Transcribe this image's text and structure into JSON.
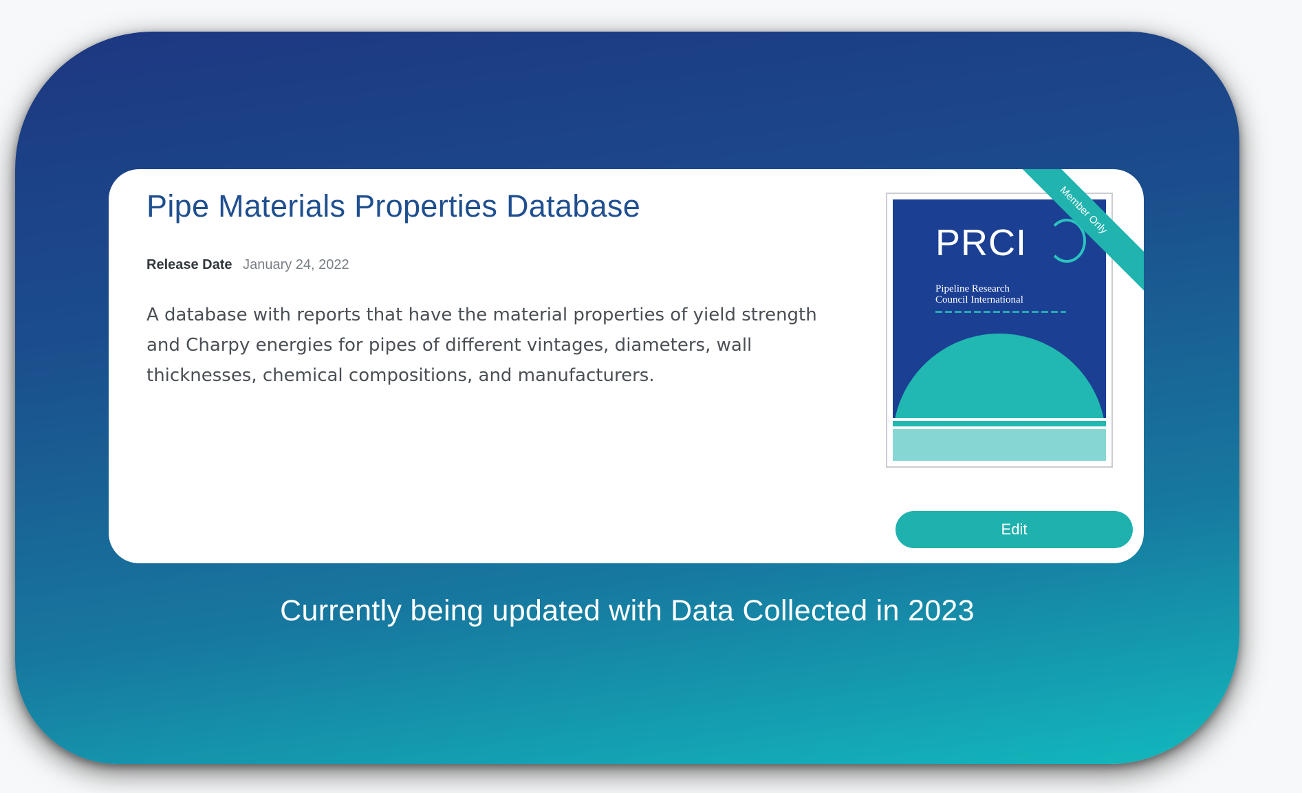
{
  "card": {
    "title": "Pipe Materials Properties Database",
    "release_label": "Release Date",
    "release_date": "January 24, 2022",
    "description": "A database with reports that have the material properties of yield strength and Charpy energies for pipes of different vintages, diameters, wall thicknesses, chemical compositions, and manufacturers.",
    "ribbon_label": "Member Only",
    "edit_label": "Edit",
    "cover": {
      "logo_text": "PRCI",
      "org_name": "Pipeline Research\nCouncil International"
    }
  },
  "footer_note": "Currently being updated with Data Collected in 2023",
  "colors": {
    "title": "#1f4f8f",
    "accent": "#1fb1ad",
    "cover_navy": "#1b3f93",
    "panel_gradient_start": "#1d3781",
    "panel_gradient_end": "#12b9bd"
  }
}
